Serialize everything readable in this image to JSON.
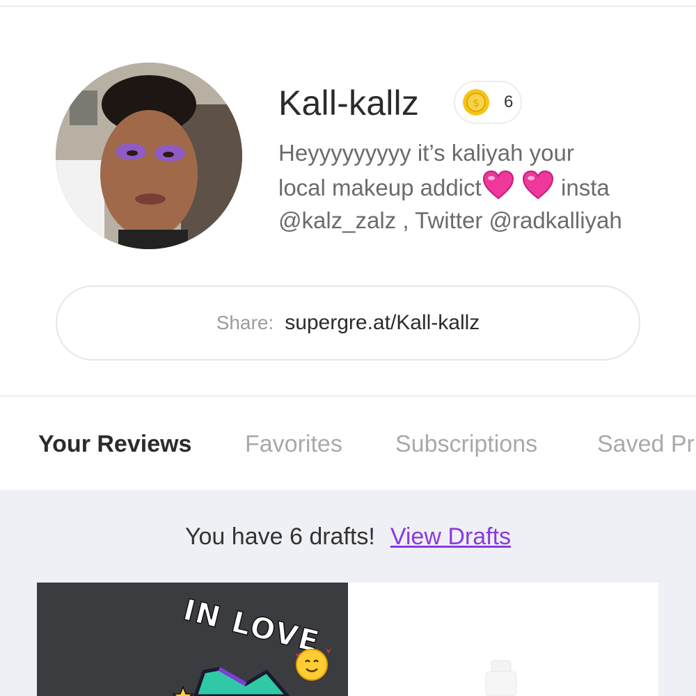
{
  "profile": {
    "username": "Kall-kallz",
    "coins": "6",
    "bio_line1": "Heyyyyyyyyy it’s kaliyah your",
    "bio_line2_start": "local makeup addict",
    "bio_line2_end": " insta",
    "bio_line3": "@kalz_zalz , Twitter @radkalliyah"
  },
  "share": {
    "label": "Share:",
    "url": "supergre.at/Kall-kallz"
  },
  "tabs": [
    {
      "label": "Your Reviews",
      "active": true
    },
    {
      "label": "Favorites",
      "active": false
    },
    {
      "label": "Subscriptions",
      "active": false
    },
    {
      "label": "Saved Pr",
      "active": false
    }
  ],
  "drafts": {
    "text": "You have 6 drafts!",
    "link": "View Drafts"
  },
  "cards": {
    "left_overlay_text": "IN LOVE"
  },
  "colors": {
    "accent": "#8a39e1",
    "content_bg": "#eff0f5",
    "coin": "#f5c518"
  },
  "icons": [
    "coin-icon",
    "heart-emoji-icon",
    "smiling-hearts-emoji-icon",
    "star-icon"
  ]
}
